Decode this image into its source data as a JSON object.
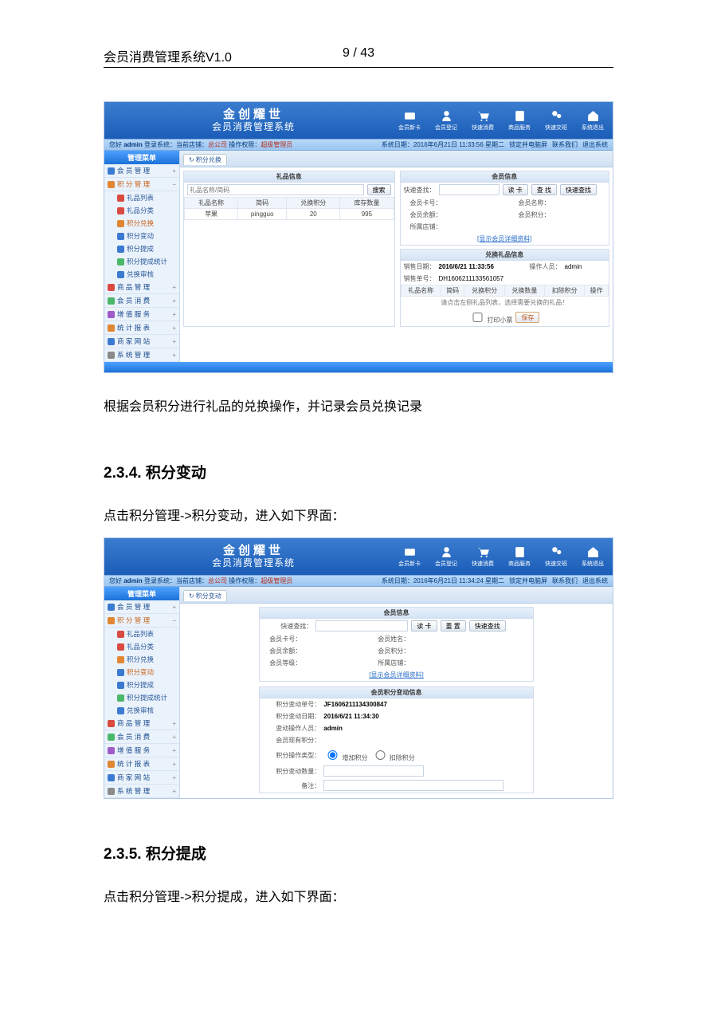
{
  "doc": {
    "title": "会员消费管理系统V1.0",
    "page": "9 / 43",
    "para1": "根据会员积分进行礼品的兑换操作，并记录会员兑换记录",
    "h234": "2.3.4. 积分变动",
    "para2": "点击积分管理->积分变动，进入如下界面：",
    "h235": "2.3.5. 积分提成",
    "para3": "点击积分管理->积分提成，进入如下界面："
  },
  "app": {
    "brand1": "金创耀世",
    "brand2": "会员消费管理系统",
    "ticons": [
      "会员新卡",
      "会员登记",
      "快速消费",
      "商品服务",
      "快速交班",
      "系统退出"
    ],
    "info_user": "admin",
    "info_store_pre": "登录系统：",
    "info_store": "当前店铺：",
    "info_company": "总公司",
    "info_op": "操作权限：",
    "info_role": "超级管理员",
    "info_r_lock": "锁定并电脑屏",
    "info_r_contact": "联系我们",
    "info_r_exit": "退出系统",
    "side_title": "管理菜单",
    "nav": [
      {
        "icon": "blue",
        "label": "会 员 管 理",
        "exp": "+"
      },
      {
        "icon": "org",
        "label": "积 分 管 理",
        "open": true,
        "exp": "−"
      },
      {
        "sub": true,
        "icon": "red",
        "label": "礼品列表"
      },
      {
        "sub": true,
        "icon": "red",
        "label": "礼品分类"
      },
      {
        "sub": true,
        "icon": "org",
        "label": "积分兑换",
        "sel1": true
      },
      {
        "sub": true,
        "icon": "blue",
        "label": "积分变动",
        "sel2": true
      },
      {
        "sub": true,
        "icon": "blue",
        "label": "积分提成"
      },
      {
        "sub": true,
        "icon": "grn",
        "label": "积分提成统计"
      },
      {
        "sub": true,
        "icon": "blue",
        "label": "兑换审核"
      },
      {
        "icon": "red",
        "label": "商 品 管 理",
        "exp": "+"
      },
      {
        "icon": "grn",
        "label": "会 员 消 费",
        "exp": "+"
      },
      {
        "icon": "pur",
        "label": "增 值 服 务",
        "exp": "+"
      },
      {
        "icon": "org",
        "label": "统 计 报 表",
        "exp": "+"
      },
      {
        "icon": "blue",
        "label": "商 家 网 站",
        "exp": "+"
      },
      {
        "icon": "gry",
        "label": "系 统 管 理",
        "exp": "+"
      }
    ]
  },
  "s1": {
    "date": "系统日期：2016年6月21日 11:33:56 星期二",
    "tab": "积分兑换",
    "gift_panel": "礼品信息",
    "search_ph": "礼品名称/简码",
    "search_btn": "搜索",
    "cols": [
      "礼品名称",
      "简码",
      "兑换积分",
      "库存数量"
    ],
    "row": [
      "苹果",
      "pingguo",
      "20",
      "995"
    ],
    "mem_panel": "会员信息",
    "quick": "快速查找：",
    "btn_card": "读 卡",
    "btn_find": "查 找",
    "btn_quick": "快速查找",
    "mem_labels": [
      "会员卡号：",
      "会员名称：",
      "会员余额：",
      "会员积分：",
      "所属店铺："
    ],
    "mem_link": "[显示会员详细资料]",
    "ex_panel": "兑换礼品信息",
    "order_date_l": "销售日期：",
    "order_date": "2016/6/21 11:33:56",
    "operator_l": "操作人员：",
    "operator": "admin",
    "order_no_l": "销售单号：",
    "order_no": "DH1606211133561057",
    "ex_cols": [
      "礼品名称",
      "简码",
      "兑换积分",
      "兑换数量",
      "扣除积分",
      "操作"
    ],
    "tip": "请点击左侧礼品列表，选择需要兑换的礼品！",
    "print": "打印小票",
    "save": "保存"
  },
  "s2": {
    "date": "系统日期：2016年6月21日 11:34:24 星期二",
    "tab": "积分变动",
    "mem_panel": "会员信息",
    "quick": "快速查找：",
    "btn_card": "读 卡",
    "btn_reset": "重 置",
    "btn_quick": "快速查找",
    "mem_labels": [
      "会员卡号：",
      "会员姓名：",
      "会员余额：",
      "会员积分：",
      "会员等级：",
      "所属店铺："
    ],
    "mem_link": "[显示会员详细资料]",
    "chg_panel": "会员积分变动信息",
    "chg_no_l": "积分变动单号：",
    "chg_no": "JF1606211134300847",
    "chg_date_l": "积分变动日期：",
    "chg_date": "2016/6/21 11:34:30",
    "chg_op_l": "变动操作人员：",
    "chg_op": "admin",
    "chg_cur_l": "会员现有积分：",
    "chg_type_l": "积分操作类型：",
    "chg_type_a": "增加积分",
    "chg_type_b": "扣除积分",
    "chg_amt_l": "积分变动数量：",
    "chg_rem_l": "备注："
  }
}
